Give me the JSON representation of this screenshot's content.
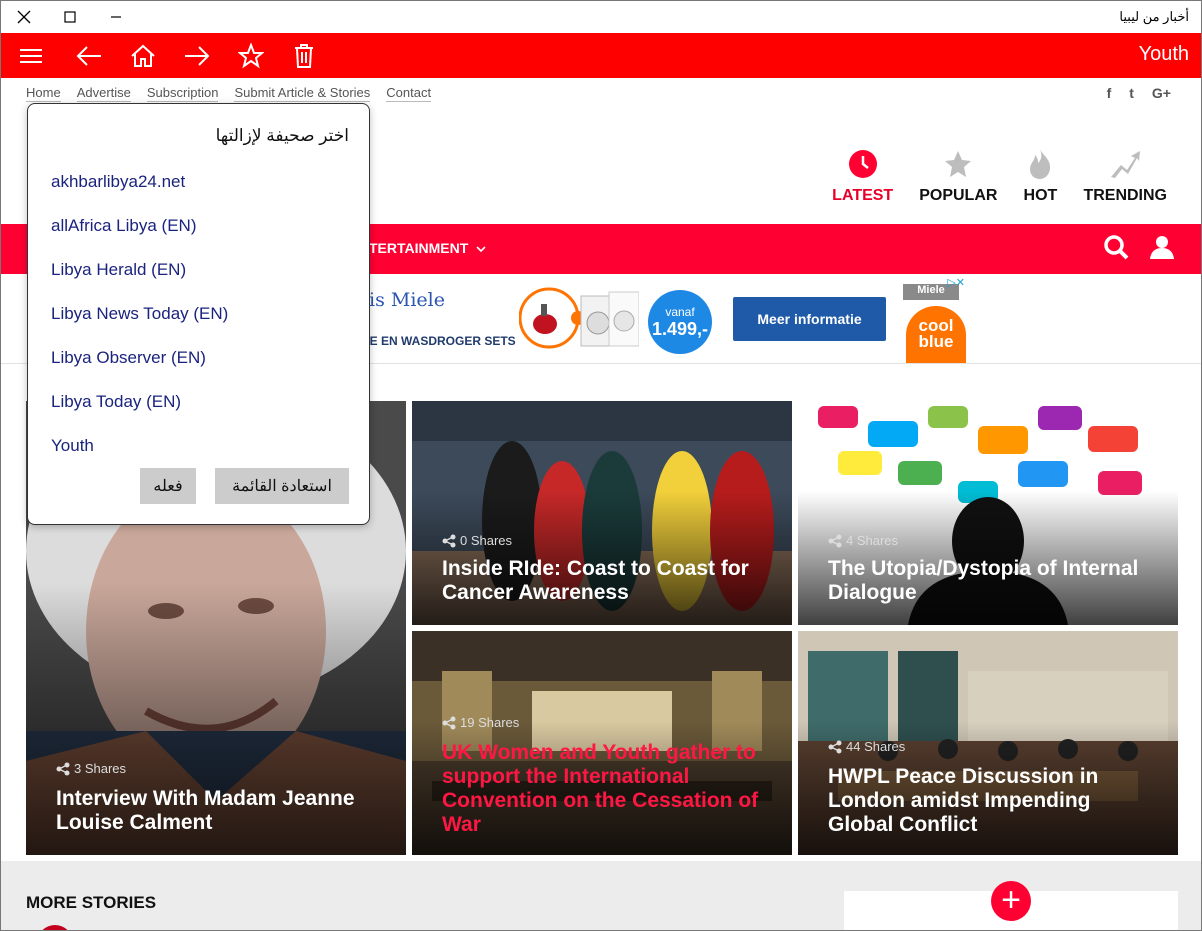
{
  "window": {
    "title": "أخبار من ليبيا"
  },
  "appbar": {
    "section": "Youth"
  },
  "topnav": [
    "Home",
    "Advertise",
    "Subscription",
    "Submit Article & Stories",
    "Contact"
  ],
  "social": [
    "f",
    "t",
    "G+"
  ],
  "categories": [
    {
      "label": "LATEST",
      "icon": "clock-icon",
      "active": true
    },
    {
      "label": "POPULAR",
      "icon": "star-icon"
    },
    {
      "label": "HOT",
      "icon": "flame-icon"
    },
    {
      "label": "TRENDING",
      "icon": "trending-arrow-icon"
    }
  ],
  "strip": {
    "menu_label": "TERTAINMENT"
  },
  "ad": {
    "brand_text": "is Miele",
    "sub_text": "HE EN WASDROGER SETS",
    "price_prefix": "vanaf",
    "price": "1.499,-",
    "button": "Meer informatie",
    "store": "cool blue",
    "badge": "Miele"
  },
  "stories": [
    {
      "shares": "3 Shares",
      "headline": "Interview With Madam Jeanne Louise Calment",
      "red": false
    },
    {
      "shares": "0 Shares",
      "headline": "Inside RIde: Coast to Coast for Cancer Awareness",
      "red": false
    },
    {
      "shares": "4 Shares",
      "headline": "The Utopia/Dystopia of Internal Dialogue",
      "red": false
    },
    {
      "shares": "19 Shares",
      "headline": "UK Women and Youth gather to support the International Convention on the Cessation of War",
      "red": true
    },
    {
      "shares": "44 Shares",
      "headline": "HWPL Peace Discussion in London amidst Impending Global Conflict",
      "red": false
    }
  ],
  "bottom": {
    "more_stories": "MORE STORIES",
    "plus": "+"
  },
  "popup": {
    "title": "اختر صحيفة لإزالتها",
    "items": [
      "akhbarlibya24.net",
      "allAfrica Libya (EN)",
      "Libya Herald (EN)",
      "Libya News Today (EN)",
      "Libya Observer (EN)",
      "Libya Today (EN)",
      "Youth"
    ],
    "btn_do": "فعله",
    "btn_restore": "استعادة القائمة"
  },
  "colors": {
    "appbar": "#ff0000",
    "strip": "#ff0033",
    "accent_text": "#e8002a",
    "popup_link": "#1a237e"
  }
}
